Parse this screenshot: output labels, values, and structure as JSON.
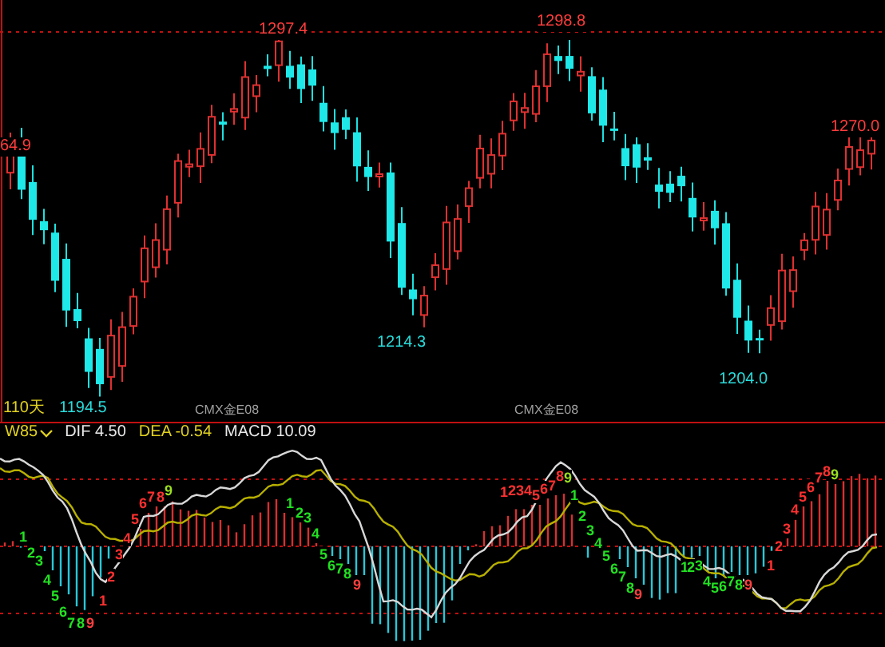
{
  "price_panel": {
    "labels": [
      {
        "text": "64.9",
        "kind": "high"
      },
      {
        "text": "1297.4",
        "kind": "high"
      },
      {
        "text": "1298.8",
        "kind": "high"
      },
      {
        "text": "1214.3",
        "kind": "low"
      },
      {
        "text": "1204.0",
        "kind": "low"
      },
      {
        "text": "1270.0",
        "kind": "high"
      },
      {
        "text": "1194.5",
        "kind": "low"
      }
    ]
  },
  "footer": {
    "period": "110天",
    "contracts": [
      "CMX金E08",
      "CMX金E08"
    ]
  },
  "macd_panel": {
    "name": "W85",
    "dif": "DIF 4.50",
    "dea": "DEA -0.54",
    "macd": "MACD 10.09",
    "td_counts": [
      {
        "kind": "buy",
        "labels": [
          "1",
          "2",
          "3",
          "4",
          "5",
          "6",
          "7",
          "8",
          "9"
        ]
      },
      {
        "kind": "sell",
        "labels": [
          "1",
          "2",
          "3",
          "4",
          "5",
          "6",
          "7",
          "8",
          "9"
        ]
      },
      {
        "kind": "buy",
        "labels": [
          "1",
          "2",
          "3",
          "4",
          "5",
          "6",
          "7",
          "8",
          "9"
        ]
      },
      {
        "kind": "sell",
        "labels": [
          "1",
          "2",
          "3",
          "4",
          "5",
          "6",
          "7",
          "8",
          "9"
        ]
      },
      {
        "kind": "buy",
        "labels": [
          "1",
          "2",
          "3",
          "4",
          "5",
          "6",
          "7",
          "8",
          "9"
        ]
      },
      {
        "kind": "buy",
        "labels": [
          "1",
          "2",
          "3",
          "4",
          "5",
          "6",
          "7",
          "8",
          "9"
        ]
      },
      {
        "kind": "sell",
        "labels": [
          "1",
          "2",
          "3",
          "4",
          "5",
          "6",
          "7",
          "8",
          "9"
        ]
      }
    ]
  }
}
